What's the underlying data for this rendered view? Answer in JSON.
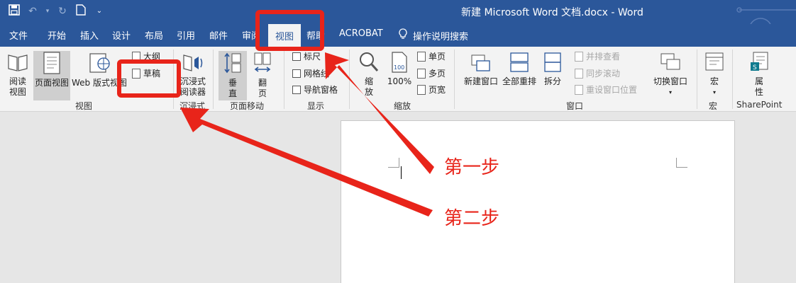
{
  "titlebar": {
    "title": "新建 Microsoft Word 文档.docx  -  Word",
    "qat": [
      {
        "icon": "save-icon",
        "glyph": "💾"
      },
      {
        "icon": "undo-icon",
        "glyph": "↶"
      },
      {
        "icon": "redo-icon",
        "glyph": "↻"
      },
      {
        "icon": "new-document-icon",
        "glyph": "▯"
      },
      {
        "icon": "customize-qat-icon",
        "glyph": "⌄"
      }
    ]
  },
  "tabs": [
    "文件",
    "开始",
    "插入",
    "设计",
    "布局",
    "引用",
    "邮件",
    "审阅",
    "视图",
    "帮助",
    "ACROBAT"
  ],
  "active_tab": "视图",
  "tell_me": "操作说明搜索",
  "ribbon": {
    "views": {
      "read_mode": "阅读\n视图",
      "print_layout": "页面视图",
      "web_layout": "Web 版式视图",
      "outline": "大纲",
      "draft": "草稿",
      "label": "视图"
    },
    "immersive": {
      "reader": "沉浸式\n阅读器",
      "label": "沉浸式"
    },
    "page_movement": {
      "vertical": "垂\n直",
      "side_to_side": "翻\n页",
      "label": "页面移动"
    },
    "show": {
      "ruler": "标尺",
      "gridlines": "网格线",
      "nav_pane": "导航窗格",
      "label": "显示"
    },
    "zoom": {
      "zoom": "缩\n放",
      "pct": "100%",
      "one_page": "单页",
      "multi_page": "多页",
      "page_width": "页宽",
      "label": "缩放"
    },
    "window": {
      "new_window": "新建窗口",
      "arrange_all": "全部重排",
      "split": "拆分",
      "side_by_side": "并排查看",
      "sync_scroll": "同步滚动",
      "reset_pos": "重设窗口位置",
      "switch_windows": "切换窗口",
      "label": "窗口"
    },
    "macros": {
      "macros": "宏",
      "label": "宏"
    },
    "sharepoint": {
      "properties": "属\n性",
      "label": "SharePoint"
    }
  },
  "annotations": {
    "step1": "第一步",
    "step2": "第二步",
    "color": "#e8241a"
  },
  "colors": {
    "brand": "#2b579a",
    "ribbon": "#f3f3f3",
    "canvas": "#e6e6e6"
  }
}
